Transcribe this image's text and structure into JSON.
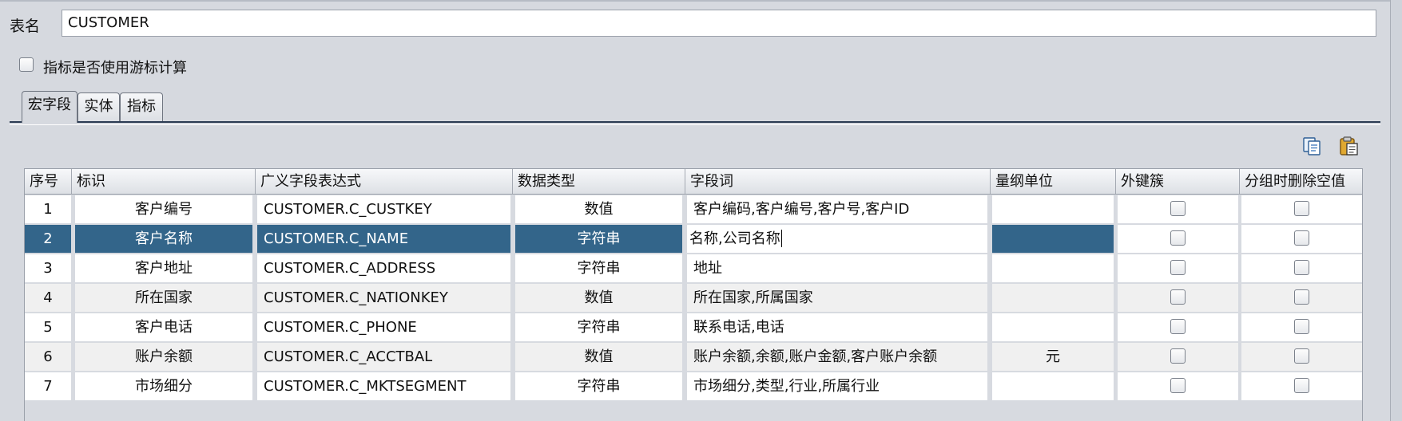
{
  "form": {
    "table_name_label": "表名",
    "table_name_value": "CUSTOMER",
    "cursor_checkbox_label": "指标是否使用游标计算",
    "cursor_checkbox_checked": false
  },
  "tabs": [
    {
      "label": "宏字段",
      "active": true
    },
    {
      "label": "实体",
      "active": false
    },
    {
      "label": "指标",
      "active": false
    }
  ],
  "toolbar": {
    "copy_icon": "copy-icon",
    "paste_icon": "paste-icon"
  },
  "table": {
    "columns": [
      "序号",
      "标识",
      "广义字段表达式",
      "数据类型",
      "字段词",
      "量纲单位",
      "外键簇",
      "分组时删除空值"
    ],
    "rows": [
      {
        "seq": "1",
        "id": "客户编号",
        "expr": "CUSTOMER.C_CUSTKEY",
        "type": "数值",
        "words": "客户编码,客户编号,客户号,客户ID",
        "unit": "",
        "fk": false,
        "drop_null": false
      },
      {
        "seq": "2",
        "id": "客户名称",
        "expr": "CUSTOMER.C_NAME",
        "type": "字符串",
        "words": "名称,公司名称",
        "unit": "",
        "fk": false,
        "drop_null": false,
        "selected": true,
        "editing": true
      },
      {
        "seq": "3",
        "id": "客户地址",
        "expr": "CUSTOMER.C_ADDRESS",
        "type": "字符串",
        "words": "地址",
        "unit": "",
        "fk": false,
        "drop_null": false
      },
      {
        "seq": "4",
        "id": "所在国家",
        "expr": "CUSTOMER.C_NATIONKEY",
        "type": "数值",
        "words": "所在国家,所属国家",
        "unit": "",
        "fk": false,
        "drop_null": false
      },
      {
        "seq": "5",
        "id": "客户电话",
        "expr": "CUSTOMER.C_PHONE",
        "type": "字符串",
        "words": "联系电话,电话",
        "unit": "",
        "fk": false,
        "drop_null": false
      },
      {
        "seq": "6",
        "id": "账户余额",
        "expr": "CUSTOMER.C_ACCTBAL",
        "type": "数值",
        "words": "账户余额,余额,账户金额,客户账户余额",
        "unit": "元",
        "fk": false,
        "drop_null": false
      },
      {
        "seq": "7",
        "id": "市场细分",
        "expr": "CUSTOMER.C_MKTSEGMENT",
        "type": "字符串",
        "words": "市场细分,类型,行业,所属行业",
        "unit": "",
        "fk": false,
        "drop_null": false
      }
    ]
  },
  "colors": {
    "selection": "#33658a",
    "background": "#d6d9df"
  }
}
